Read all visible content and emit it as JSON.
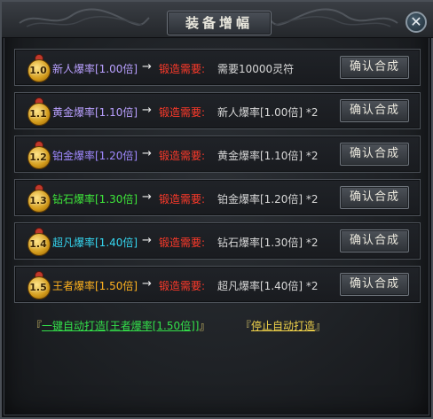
{
  "window": {
    "title": "装备增幅",
    "close_glyph": "✕"
  },
  "arrow_glyph": "→",
  "rows": [
    {
      "level": "1.0",
      "name": "新人爆率[1.00倍]",
      "name_color": "#b9a0ff",
      "req_label": "锻造需要:",
      "req_value": "需要10000灵符",
      "button": "确认合成"
    },
    {
      "level": "1.1",
      "name": "黄金爆率[1.10倍]",
      "name_color": "#b9a0ff",
      "req_label": "锻造需要:",
      "req_value": "新人爆率[1.00倍] *2",
      "button": "确认合成"
    },
    {
      "level": "1.2",
      "name": "铂金爆率[1.20倍]",
      "name_color": "#a089ff",
      "req_label": "锻造需要:",
      "req_value": "黄金爆率[1.10倍] *2",
      "button": "确认合成"
    },
    {
      "level": "1.3",
      "name": "钻石爆率[1.30倍]",
      "name_color": "#3ee63a",
      "req_label": "锻造需要:",
      "req_value": "铂金爆率[1.20倍] *2",
      "button": "确认合成"
    },
    {
      "level": "1.4",
      "name": "超凡爆率[1.40倍]",
      "name_color": "#35d6f0",
      "req_label": "锻造需要:",
      "req_value": "钻石爆率[1.30倍] *2",
      "button": "确认合成"
    },
    {
      "level": "1.5",
      "name": "王者爆率[1.50倍]",
      "name_color": "#ffb21f",
      "req_label": "锻造需要:",
      "req_value": "超凡爆率[1.40倍] *2",
      "button": "确认合成"
    }
  ],
  "footer": {
    "auto_forge": {
      "open": "『",
      "text": "一键自动打造[王者爆率[1.50倍]]",
      "close": "』",
      "color": "#33e04a"
    },
    "stop_forge": {
      "open": "『",
      "text": "停止自动打造",
      "close": "』",
      "color": "#f0d24a"
    }
  },
  "colors": {
    "req_label": "#ff3a2a",
    "bracket": "#e8d470"
  }
}
